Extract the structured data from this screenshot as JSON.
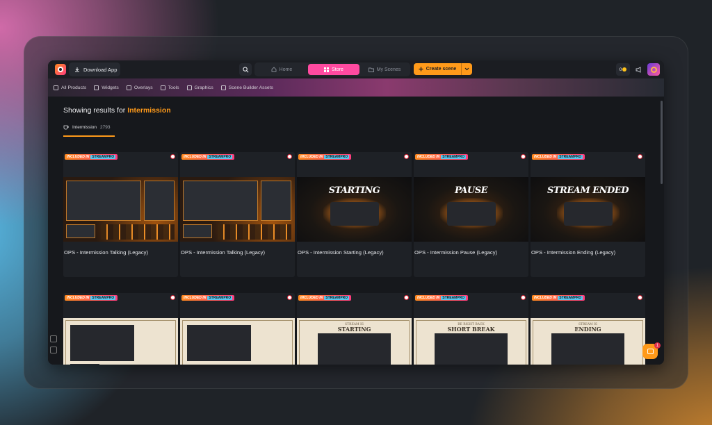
{
  "topbar": {
    "download_label": "Download App",
    "tabs": {
      "home": "Home",
      "store": "Store",
      "scenes": "My Scenes"
    },
    "create_label": "Create scene",
    "coins": "0"
  },
  "categories": [
    "All Products",
    "Widgets",
    "Overlays",
    "Tools",
    "Graphics",
    "Scene Builder Assets"
  ],
  "results": {
    "prefix": "Showing results for",
    "term": "Intermission"
  },
  "chip": {
    "label": "Intermission",
    "count": "2793"
  },
  "badge": {
    "included": "INCLUDED IN",
    "brand": "STREAMPRO"
  },
  "cards": [
    {
      "title": "OPS - Intermission Talking (Legacy)"
    },
    {
      "title": "OPS - Intermission Talking (Legacy)"
    },
    {
      "title": "OPS - Intermission Starting (Legacy)",
      "word": "STARTING"
    },
    {
      "title": "OPS - Intermission Pause (Legacy)",
      "word": "PAUSE"
    },
    {
      "title": "OPS - Intermission Ending (Legacy)",
      "word": "STREAM ENDED"
    }
  ],
  "paper_cards": [
    {
      "kicker": "",
      "label": ""
    },
    {
      "kicker": "",
      "label": ""
    },
    {
      "kicker": "STREAM IS",
      "label": "STARTING"
    },
    {
      "kicker": "BE RIGHT BACK",
      "label": "SHORT BREAK"
    },
    {
      "kicker": "STREAM IS",
      "label": "ENDING"
    }
  ],
  "chat": {
    "count": "1"
  }
}
